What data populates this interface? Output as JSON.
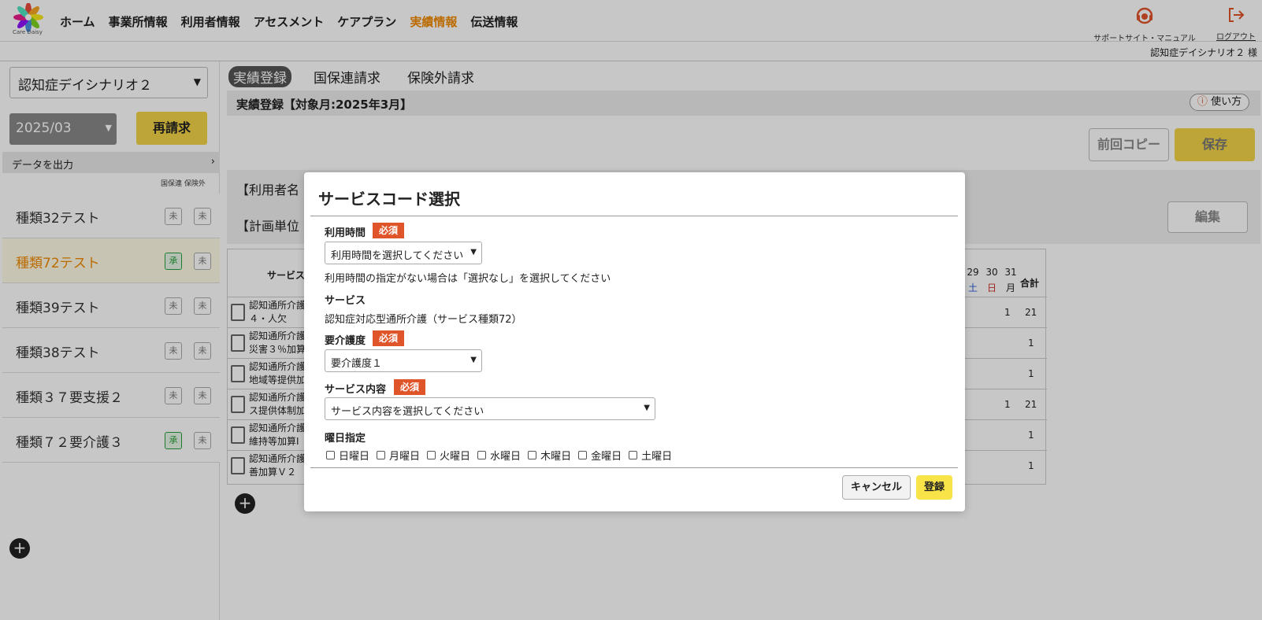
{
  "header": {
    "logo_text": "Care Daisy",
    "nav": [
      "ホーム",
      "事業所情報",
      "利用者情報",
      "アセスメント",
      "ケアプラン",
      "実績情報",
      "伝送情報"
    ],
    "active_nav": "実績情報",
    "support_label": "サポートサイト・マニュアル",
    "logout_label": "ログアウト",
    "user_name": "認知症デイシナリオ２ 様"
  },
  "sidebar": {
    "scenario": "認知症デイシナリオ２",
    "month": "2025/03",
    "rebill_label": "再請求",
    "export_label": "データを出力",
    "column_headers": "国保連  保険外",
    "users": [
      {
        "name": "種類32テスト",
        "b1": "未",
        "b2": "未"
      },
      {
        "name": "種類72テスト",
        "b1": "承",
        "b2": "未"
      },
      {
        "name": "種類39テスト",
        "b1": "未",
        "b2": "未"
      },
      {
        "name": "種類38テスト",
        "b1": "未",
        "b2": "未"
      },
      {
        "name": "種類３７要支援２",
        "b1": "未",
        "b2": "未"
      },
      {
        "name": "種類７２要介護３",
        "b1": "承",
        "b2": "未"
      }
    ]
  },
  "main": {
    "tabs": [
      "実績登録",
      "国保連請求",
      "保険外請求"
    ],
    "title": "実績登録【対象月:2025年3月】",
    "howto_label": "使い方",
    "copy_label": "前回コピー",
    "save_label": "保存",
    "user_label": "【利用者名",
    "plan_label": "【計画単位",
    "edit_label": "編集",
    "grid": {
      "service_header": "サービス",
      "day_numbers": [
        "29",
        "30",
        "31"
      ],
      "day_names": [
        "土",
        "日",
        "月"
      ],
      "total_header": "合計",
      "rows": [
        {
          "l1": "認知通所介護",
          "l2": "４・人欠",
          "val31": "1",
          "total": "21"
        },
        {
          "l1": "認知通所介護",
          "l2": "災害３％加算",
          "val31": "",
          "total": "1"
        },
        {
          "l1": "認知通所介護",
          "l2": "地域等提供加",
          "val31": "",
          "total": "1"
        },
        {
          "l1": "認知通所介護",
          "l2": "ス提供体制加",
          "val31": "1",
          "total": "21"
        },
        {
          "l1": "認知通所介護",
          "l2": "維持等加算Ⅰ",
          "val31": "",
          "total": "1"
        },
        {
          "l1": "認知通所介護",
          "l2": "善加算Ｖ２",
          "val31": "",
          "total": "1"
        }
      ]
    }
  },
  "modal": {
    "title": "サービスコード選択",
    "required_label": "必須",
    "usage_time_label": "利用時間",
    "usage_time_placeholder": "利用時間を選択してください",
    "usage_time_note": "利用時間の指定がない場合は「選択なし」を選択してください",
    "service_label": "サービス",
    "service_value": "認知症対応型通所介護（サービス種類72）",
    "care_level_label": "要介護度",
    "care_level_value": "要介護度１",
    "service_content_label": "サービス内容",
    "service_content_placeholder": "サービス内容を選択してください",
    "weekday_label": "曜日指定",
    "weekdays": [
      "日曜日",
      "月曜日",
      "火曜日",
      "水曜日",
      "木曜日",
      "金曜日",
      "土曜日"
    ],
    "cancel_label": "キャンセル",
    "register_label": "登録"
  },
  "colors": {
    "accent": "#f08a00",
    "yellow": "#f3d547",
    "required": "#e0542a"
  }
}
